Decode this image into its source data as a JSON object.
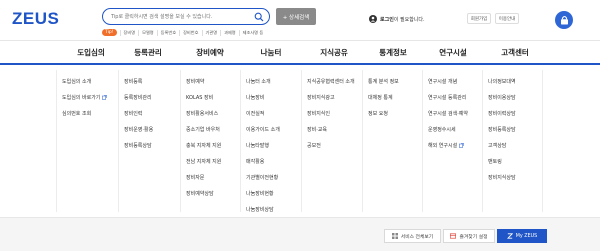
{
  "header": {
    "logo": "ZEUS",
    "search_placeholder": "Tip로 클릭하시면 검색 설명을 보실 수 있습니다.",
    "detail_search_label": "+ 상세검색",
    "hot_badge": "Tip!",
    "hot_keywords": [
      "장비명",
      "모델명",
      "등록번호",
      "장비번호",
      "기관명",
      "과제명",
      "제조사명 등"
    ],
    "login_prefix": "로그인",
    "login_suffix": "이 필요합니다.",
    "join_label": "회원가입",
    "help_label": "이용안내",
    "colors": {
      "brand": "#1f55c6",
      "hot": "#f0702b"
    }
  },
  "gnb": {
    "items": [
      "도입심의",
      "등록관리",
      "장비예약",
      "나눔터",
      "지식공유",
      "통계정보",
      "연구시설",
      "고객센터"
    ]
  },
  "mega": {
    "columns": [
      [
        "도입심의 소개",
        "도입심의 바로가기",
        "심의번호 조회"
      ],
      [
        "장비등록",
        "등록장비관리",
        "장비인력",
        "장비운영·활용",
        "장비등록상담"
      ],
      [
        "장비예약",
        "KOLAS 장비",
        "장비활용서비스",
        "중소기업 바우처",
        "충북 지자체 지원",
        "전남 지자체 지원",
        "장비자문",
        "장비예약상담"
      ],
      [
        "나눔터 소개",
        "나눔장비",
        "이전실적",
        "이용가이드 소개",
        "나눔타발행",
        "매각활용",
        "기관별이전현황",
        "나눔장비현황",
        "나눔장비상담"
      ],
      [
        "지식공유협력센터 소개",
        "장비지식광고",
        "장비지식인",
        "장비·교육",
        "공모전"
      ],
      [
        "통계 분석 정보",
        "대체정 통계",
        "정보 요청"
      ],
      [
        "연구시설 개념",
        "연구시설 등록관리",
        "연구시설 검색·예약",
        "운영정수시세",
        "해외 연구시설"
      ],
      [
        "나의정보대역",
        "장비이용상담",
        "장비이력상담",
        "장비등록상담",
        "고객상담",
        "맨토링",
        "장비지식상담"
      ]
    ],
    "external_link_items": [
      "도입심의 바로가기",
      "해외 연구시설"
    ]
  },
  "bottom": {
    "service_all_label": "서비스 전체보기",
    "favorites_label": "즐겨찾기 설정",
    "my_zeus_label": "My ZEUS"
  }
}
